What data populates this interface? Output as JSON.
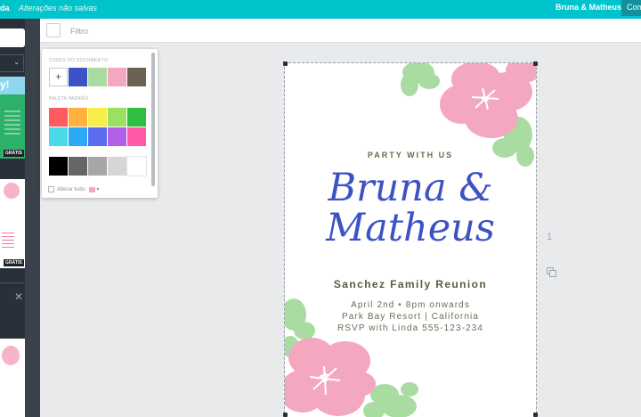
{
  "topbar": {
    "menu_tail": "da",
    "unsaved_status": "Alterações não salvas",
    "design_title": "Bruna & Matheus",
    "share_button": "Com"
  },
  "sidebar": {
    "thumb_1_heading": "y!",
    "thumb_1_badge": "GRÁTIS",
    "thumb_2_badge": "GRÁTIS",
    "close_symbol": "✕"
  },
  "toolbar": {
    "filter_label": "Filtro"
  },
  "color_popup": {
    "document_colors_label": "CORES DO DOCUMENTO",
    "add_color_symbol": "+",
    "document_colors": [
      "#3d52c4",
      "#a8dca0",
      "#f4a8c0",
      "#6b6254"
    ],
    "default_palette_label": "PALETA PADRÃO",
    "palette_row_1": [
      "#ff5a5f",
      "#ffb13b",
      "#f7ee4a",
      "#9be062",
      "#2fbf40"
    ],
    "palette_row_2": [
      "#4ad9e8",
      "#2aa9f5",
      "#5a6cf0",
      "#b15ee8",
      "#ff5aa8"
    ],
    "grayscale": [
      "#000000",
      "#666666",
      "#a6a6a6",
      "#d6d6d6",
      "#ffffff"
    ],
    "change_all_label": "Alterar tudo:"
  },
  "design": {
    "kicker": "PARTY WITH US",
    "names_line_1": "Bruna &",
    "names_line_2": "Matheus",
    "event_name": "Sanchez Family Reunion",
    "date_time": "April 2nd • 8pm onwards",
    "location": "Park Bay Resort | California",
    "rsvp": "RSVP with Linda 555-123-234",
    "colors": {
      "names": "#3d52c4",
      "flower_pink": "#f4a8c0",
      "flower_green": "#a8dca0"
    }
  },
  "canvas_tools": {
    "page_number": "1",
    "copy_icon": "copy-icon"
  }
}
